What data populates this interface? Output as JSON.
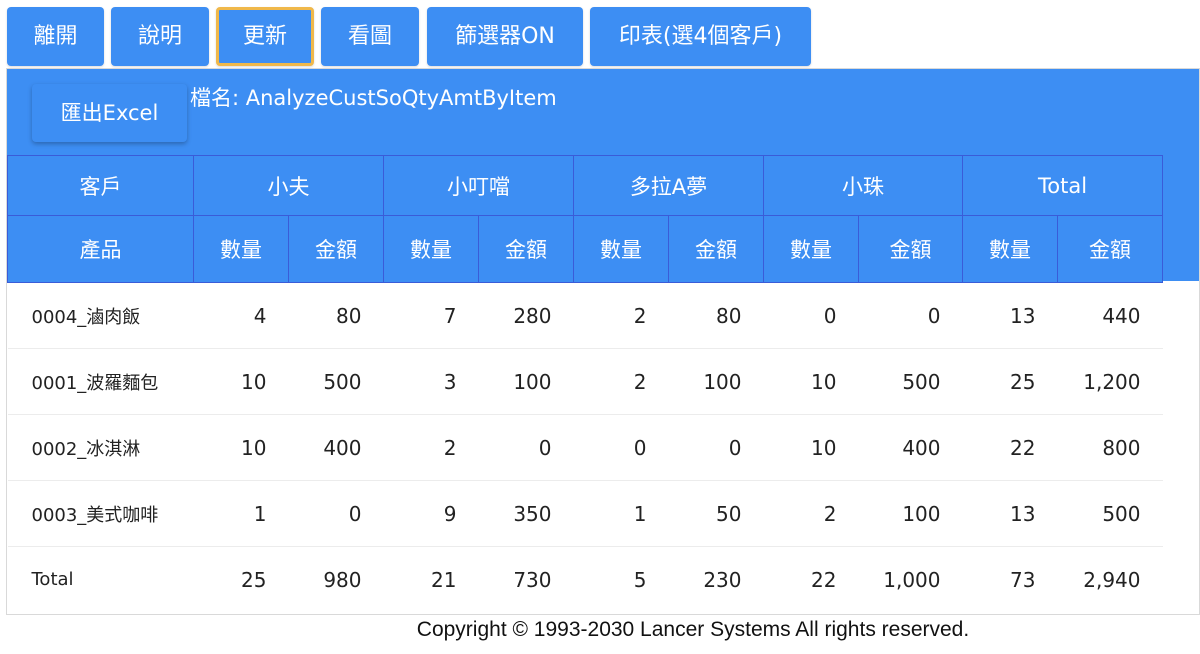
{
  "toolbar": {
    "buttons": [
      {
        "label": "離開"
      },
      {
        "label": "說明"
      },
      {
        "label": "更新"
      },
      {
        "label": "看圖"
      },
      {
        "label": "篩選器ON"
      },
      {
        "label": "印表(選4個客戶)"
      }
    ]
  },
  "panel": {
    "export_label": "匯出Excel",
    "file_label": "檔名: AnalyzeCustSoQtyAmtByItem"
  },
  "table": {
    "customer_header": "客戶",
    "product_header": "產品",
    "customers": [
      "小夫",
      "小叮噹",
      "多拉A夢",
      "小珠",
      "Total"
    ],
    "qty_header": "數量",
    "amt_header": "金額",
    "rows": [
      {
        "product": "0004_滷肉飯",
        "values": [
          "4",
          "80",
          "7",
          "280",
          "2",
          "80",
          "0",
          "0",
          "13",
          "440"
        ]
      },
      {
        "product": "0001_波羅麵包",
        "values": [
          "10",
          "500",
          "3",
          "100",
          "2",
          "100",
          "10",
          "500",
          "25",
          "1,200"
        ]
      },
      {
        "product": "0002_冰淇淋",
        "values": [
          "10",
          "400",
          "2",
          "0",
          "0",
          "0",
          "10",
          "400",
          "22",
          "800"
        ]
      },
      {
        "product": "0003_美式咖啡",
        "values": [
          "1",
          "0",
          "9",
          "350",
          "1",
          "50",
          "2",
          "100",
          "13",
          "500"
        ]
      },
      {
        "product": "Total",
        "values": [
          "25",
          "980",
          "21",
          "730",
          "5",
          "230",
          "22",
          "1,000",
          "73",
          "2,940"
        ]
      }
    ]
  },
  "footer": {
    "copyright": "Copyright © 1993-2030 Lancer Systems All rights reserved."
  },
  "colors": {
    "primary": "#3d8ef3",
    "active_border": "#f0b84a",
    "header_border": "#3a5cd8"
  }
}
